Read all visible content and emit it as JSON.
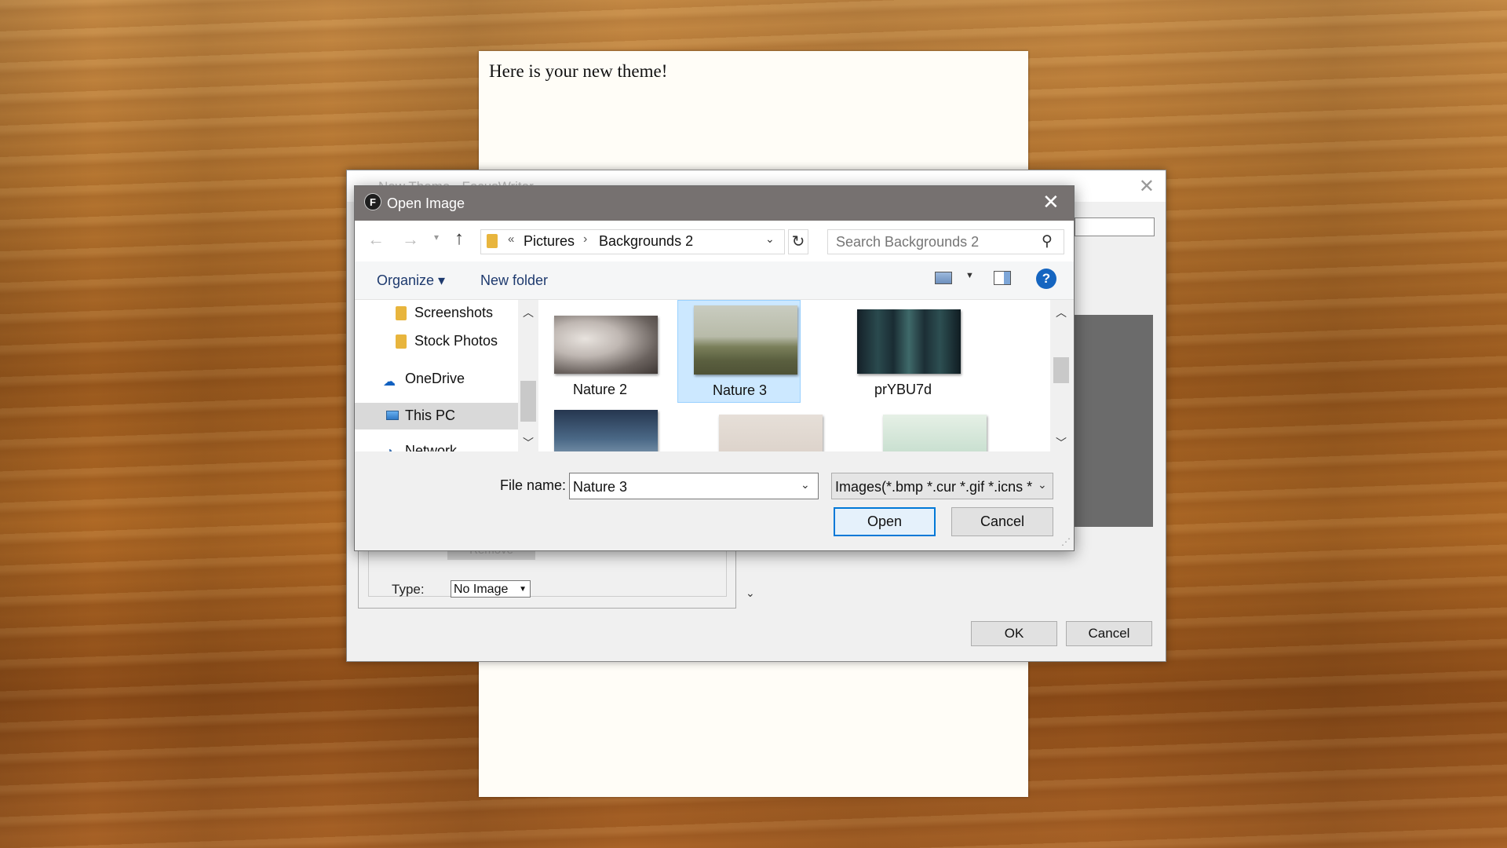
{
  "document": {
    "text": "Here is your new theme!"
  },
  "theme_dialog": {
    "title": "New Theme - FocusWriter",
    "remove_label": "Remove",
    "type_label": "Type:",
    "type_value": "No Image",
    "ok_label": "OK",
    "cancel_label": "Cancel"
  },
  "open_dialog": {
    "title": "Open Image",
    "app_icon_letter": "F",
    "address": {
      "overflow_glyph": "«",
      "crumbs": [
        "Pictures",
        "Backgrounds 2"
      ],
      "separator": "›"
    },
    "search": {
      "placeholder": "Search Backgrounds 2"
    },
    "toolbar": {
      "organize_label": "Organize ▾",
      "new_folder_label": "New folder",
      "help_glyph": "?"
    },
    "nav_items": [
      {
        "label": "Screenshots",
        "icon": "folder-icon"
      },
      {
        "label": "Stock Photos",
        "icon": "folder-icon"
      },
      {
        "label": "OneDrive",
        "icon": "onedrive-icon"
      },
      {
        "label": "This PC",
        "icon": "this-pc-icon",
        "selected": true
      },
      {
        "label": "Network",
        "icon": "network-icon"
      }
    ],
    "files": [
      {
        "name": "Nature 2",
        "selected": false
      },
      {
        "name": "Nature 3",
        "selected": true
      },
      {
        "name": "prYBU7d",
        "selected": false
      }
    ],
    "filename_label": "File name:",
    "filename_value": "Nature 3",
    "filetype_value": "Images(*.bmp *.cur *.gif *.icns *",
    "open_label": "Open",
    "cancel_label": "Cancel"
  }
}
